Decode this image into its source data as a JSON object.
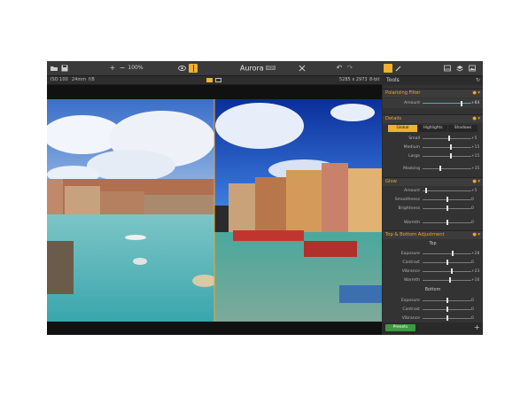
{
  "toolbar": {
    "zoom": "100%",
    "app_title": "Aurora",
    "app_badge": "HDR",
    "icons": [
      "folder-icon",
      "save-icon",
      "zoom-in-icon",
      "zoom-out-icon",
      "eye-icon",
      "compare-icon",
      "crop-icon",
      "undo-icon",
      "redo-icon",
      "tools-icon",
      "brush-icon",
      "panel-icon",
      "layers-icon",
      "image-icon"
    ]
  },
  "infobar": {
    "iso": "ISO 100",
    "focal": "24mm",
    "aperture": "f/8",
    "dimensions": "5285 x 2973",
    "bitdepth": "8-bit"
  },
  "panel": {
    "title": "Tools",
    "polarizing": {
      "title": "Polarizing Filter",
      "amount_label": "Amount",
      "amount_value": "+64",
      "amount_level": 0.82
    },
    "details": {
      "title": "Details",
      "tabs": [
        "Global",
        "Highlights",
        "Shadows"
      ],
      "active_tab": "Global",
      "rows": [
        {
          "label": "Small",
          "value": "+5",
          "level": 0.55
        },
        {
          "label": "Medium",
          "value": "+15",
          "level": 0.58
        },
        {
          "label": "Large",
          "value": "+15",
          "level": 0.58
        },
        {
          "label": "Masking",
          "value": "+35",
          "level": 0.35
        }
      ]
    },
    "glow": {
      "title": "Glow",
      "rows": [
        {
          "label": "Amount",
          "value": "+5",
          "level": 0.06
        },
        {
          "label": "Smoothness",
          "value": "0",
          "level": 0.5
        },
        {
          "label": "Brightness",
          "value": "0",
          "level": 0.5
        },
        {
          "label": "Warmth",
          "value": "0",
          "level": 0.5
        }
      ]
    },
    "topbottom": {
      "title": "Top & Bottom Adjustment",
      "top_label": "Top",
      "top_rows": [
        {
          "label": "Exposure",
          "value": "+28",
          "level": 0.62
        },
        {
          "label": "Contrast",
          "value": "0",
          "level": 0.5
        },
        {
          "label": "Vibrance",
          "value": "+23",
          "level": 0.6
        },
        {
          "label": "Warmth",
          "value": "+16",
          "level": 0.57
        }
      ],
      "bottom_label": "Bottom",
      "bottom_rows": [
        {
          "label": "Exposure",
          "value": "0",
          "level": 0.5
        },
        {
          "label": "Contrast",
          "value": "0",
          "level": 0.5
        },
        {
          "label": "Vibrance",
          "value": "0",
          "level": 0.5
        }
      ]
    },
    "presets_label": "Presets",
    "add_label": "+"
  },
  "colors": {
    "accent": "#f0a52b",
    "panel_bg": "#333333",
    "presets_green": "#3c9b3c"
  }
}
